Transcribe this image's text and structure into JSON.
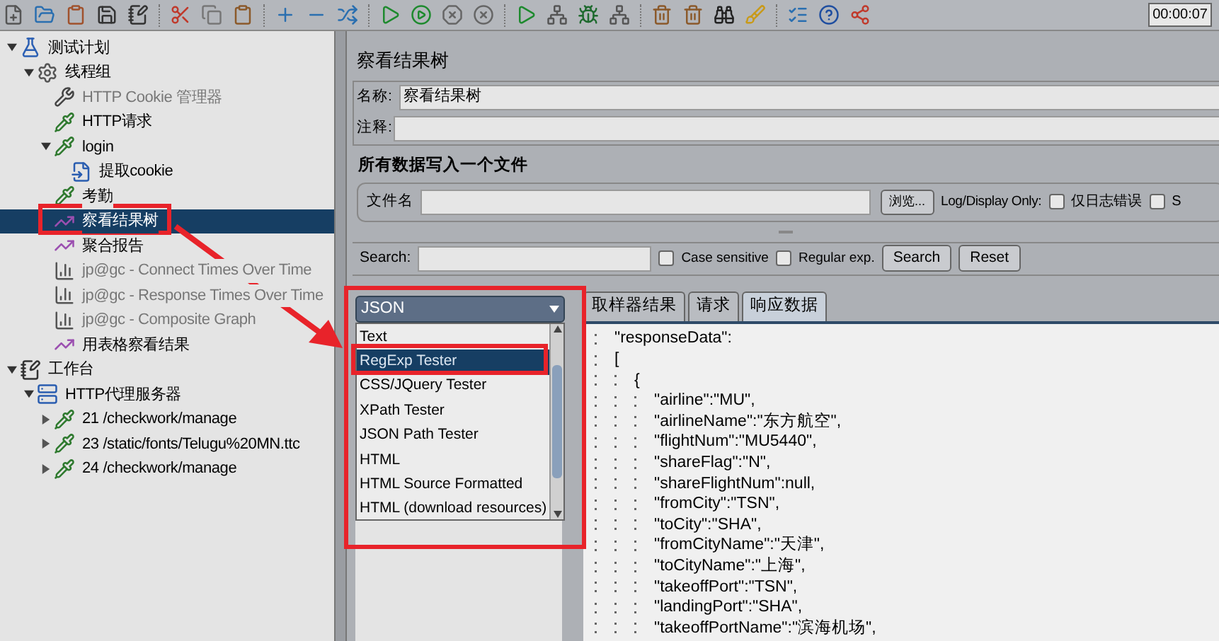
{
  "toolbar": {
    "timer": "00:00:07"
  },
  "tree": [
    {
      "label": "测试计划",
      "kind": "plan",
      "selected": false,
      "disabled": false,
      "expanded": true,
      "children": [
        {
          "label": "线程组",
          "kind": "threads",
          "selected": false,
          "disabled": false,
          "expanded": true,
          "children": [
            {
              "label": "HTTP Cookie 管理器",
              "kind": "config",
              "selected": false,
              "disabled": true
            },
            {
              "label": "HTTP请求",
              "kind": "sampler",
              "selected": false,
              "disabled": false
            },
            {
              "label": "login",
              "kind": "sampler",
              "selected": false,
              "disabled": false,
              "expanded": true,
              "children": [
                {
                  "label": "提取cookie",
                  "kind": "extractor",
                  "selected": false,
                  "disabled": false
                }
              ]
            },
            {
              "label": "考勤",
              "kind": "sampler",
              "selected": false,
              "disabled": false
            },
            {
              "label": "察看结果树",
              "kind": "listener",
              "selected": true,
              "disabled": false
            },
            {
              "label": "聚合报告",
              "kind": "listener",
              "selected": false,
              "disabled": false
            },
            {
              "label": "jp@gc - Connect Times Over Time",
              "kind": "graph",
              "selected": false,
              "disabled": true
            },
            {
              "label": "jp@gc - Response Times Over Time",
              "kind": "graph",
              "selected": false,
              "disabled": true
            },
            {
              "label": "jp@gc - Composite Graph",
              "kind": "graph",
              "selected": false,
              "disabled": true
            },
            {
              "label": "用表格察看结果",
              "kind": "listener",
              "selected": false,
              "disabled": false
            }
          ]
        }
      ]
    },
    {
      "label": "工作台",
      "kind": "workbench",
      "selected": false,
      "disabled": false,
      "expanded": true,
      "children": [
        {
          "label": "HTTP代理服务器",
          "kind": "proxy",
          "selected": false,
          "disabled": false,
          "expanded": true,
          "children": [
            {
              "label": "21 /checkwork/manage",
              "kind": "sampler",
              "selected": false,
              "disabled": false,
              "expanded": false
            },
            {
              "label": "23 /static/fonts/Telugu%20MN.ttc",
              "kind": "sampler",
              "selected": false,
              "disabled": false,
              "expanded": false
            },
            {
              "label": "24 /checkwork/manage",
              "kind": "sampler",
              "selected": false,
              "disabled": false,
              "expanded": false
            }
          ]
        }
      ]
    }
  ],
  "panel": {
    "title": "察看结果树",
    "name_label": "名称:",
    "name_value": "察看结果树",
    "comment_label": "注释:",
    "file_group": {
      "title": "所有数据写入一个文件",
      "file_label": "文件名",
      "browse_button": "浏览...",
      "log_label": "Log/Display Only:",
      "checkboxes": [
        {
          "label": "仅日志错误",
          "checked": false
        },
        {
          "label": "S",
          "checked": false
        }
      ]
    },
    "search": {
      "label": "Search:",
      "checkboxes": [
        {
          "label": "Case sensitive",
          "checked": false
        },
        {
          "label": "Regular exp.",
          "checked": false
        }
      ],
      "buttons": [
        "Search",
        "Reset"
      ]
    },
    "renderer": {
      "value": "JSON",
      "options": [
        {
          "label": "Text",
          "selected": false
        },
        {
          "label": "RegExp Tester",
          "selected": true
        },
        {
          "label": "CSS/JQuery Tester",
          "selected": false
        },
        {
          "label": "XPath Tester",
          "selected": false
        },
        {
          "label": "JSON Path Tester",
          "selected": false
        },
        {
          "label": "HTML",
          "selected": false
        },
        {
          "label": "HTML Source Formatted",
          "selected": false
        },
        {
          "label": "HTML (download resources)",
          "selected": false
        }
      ]
    },
    "tabs": [
      {
        "label": "取样器结果",
        "selected": false
      },
      {
        "label": "请求",
        "selected": false
      },
      {
        "label": "响应数据",
        "selected": true
      }
    ],
    "response_lines": [
      {
        "text": "\"responseData\":"
      },
      {
        "text": "[",
        "children": [
          {
            "text": "{",
            "children": [
              {
                "text": "\"airline\":\"MU\","
              },
              {
                "text": "\"airlineName\":\"东方航空\","
              },
              {
                "text": "\"flightNum\":\"MU5440\","
              },
              {
                "text": "\"shareFlag\":\"N\","
              },
              {
                "text": "\"shareFlightNum\":null,"
              },
              {
                "text": "\"fromCity\":\"TSN\","
              },
              {
                "text": "\"toCity\":\"SHA\","
              },
              {
                "text": "\"fromCityName\":\"天津\","
              },
              {
                "text": "\"toCityName\":\"上海\","
              },
              {
                "text": "\"takeoffPort\":\"TSN\","
              },
              {
                "text": "\"landingPort\":\"SHA\","
              },
              {
                "text": "\"takeoffPortName\":\"滨海机场\","
              }
            ]
          }
        ]
      }
    ]
  }
}
